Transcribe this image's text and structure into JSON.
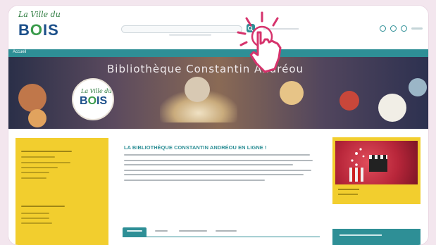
{
  "site": {
    "logo_script": "La Ville du",
    "logo_big_prefix": "B",
    "logo_big_o": "O",
    "logo_big_suffix": "IS"
  },
  "nav": {
    "home_label": "Accueil"
  },
  "banner": {
    "title": "Bibliothèque Constantin Andréou",
    "badge_script": "La Ville du",
    "badge_big_prefix": "B",
    "badge_big_o": "O",
    "badge_big_suffix": "IS"
  },
  "main": {
    "title": "LA BIBLIOTHÈQUE CONSTANTIN ANDRÉOU EN LIGNE !"
  },
  "icons": {
    "search": "search-icon",
    "account": "user-icon",
    "pointer": "hand-pointer-icon"
  },
  "colors": {
    "accent": "#2e8f96",
    "sidebar": "#f2ce2e",
    "logo_blue": "#1b4f8a",
    "logo_green": "#3a9b4b",
    "pointer": "#d6336c"
  }
}
